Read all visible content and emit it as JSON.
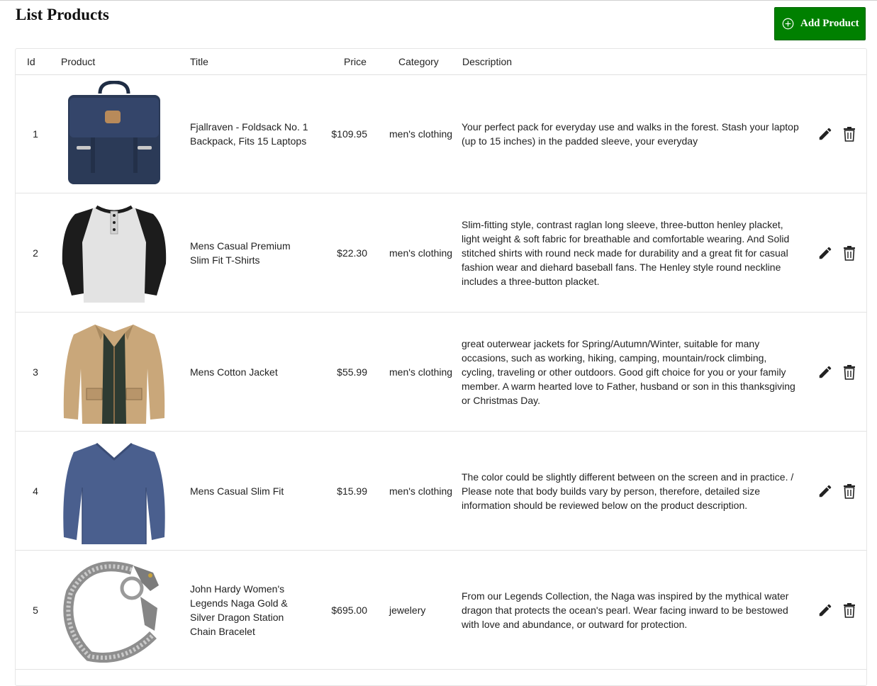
{
  "page": {
    "title": "List Products",
    "add_button_label": "Add Product"
  },
  "colors": {
    "accent": "#008000",
    "text": "#222222",
    "border": "#e3e3e3"
  },
  "table": {
    "headers": [
      "Id",
      "Product",
      "Title",
      "Price",
      "Category",
      "Description"
    ],
    "rows": [
      {
        "id": "1",
        "image": "backpack-image",
        "title": "Fjallraven - Foldsack No. 1 Backpack, Fits 15 Laptops",
        "price": "$109.95",
        "category": "men's clothing",
        "description": "Your perfect pack for everyday use and walks in the forest. Stash your laptop (up to 15 inches) in the padded sleeve, your everyday"
      },
      {
        "id": "2",
        "image": "henley-shirt-image",
        "title": "Mens Casual Premium Slim Fit T-Shirts",
        "price": "$22.30",
        "category": "men's clothing",
        "description": "Slim-fitting style, contrast raglan long sleeve, three-button henley placket, light weight & soft fabric for breathable and comfortable wearing. And Solid stitched shirts with round neck made for durability and a great fit for casual fashion wear and diehard baseball fans. The Henley style round neckline includes a three-button placket."
      },
      {
        "id": "3",
        "image": "cotton-jacket-image",
        "title": "Mens Cotton Jacket",
        "price": "$55.99",
        "category": "men's clothing",
        "description": "great outerwear jackets for Spring/Autumn/Winter, suitable for many occasions, such as working, hiking, camping, mountain/rock climbing, cycling, traveling or other outdoors. Good gift choice for you or your family member. A warm hearted love to Father, husband or son in this thanksgiving or Christmas Day."
      },
      {
        "id": "4",
        "image": "slim-fit-shirt-image",
        "title": "Mens Casual Slim Fit",
        "price": "$15.99",
        "category": "men's clothing",
        "description": "The color could be slightly different between on the screen and in practice. / Please note that body builds vary by person, therefore, detailed size information should be reviewed below on the product description."
      },
      {
        "id": "5",
        "image": "bracelet-image",
        "title": "John Hardy Women's Legends Naga Gold & Silver Dragon Station Chain Bracelet",
        "price": "$695.00",
        "category": "jewelery",
        "description": "From our Legends Collection, the Naga was inspired by the mythical water dragon that protects the ocean's pearl. Wear facing inward to be bestowed with love and abundance, or outward for protection."
      }
    ]
  },
  "row_actions": {
    "edit_icon": "pencil-icon",
    "delete_icon": "trash-icon"
  }
}
